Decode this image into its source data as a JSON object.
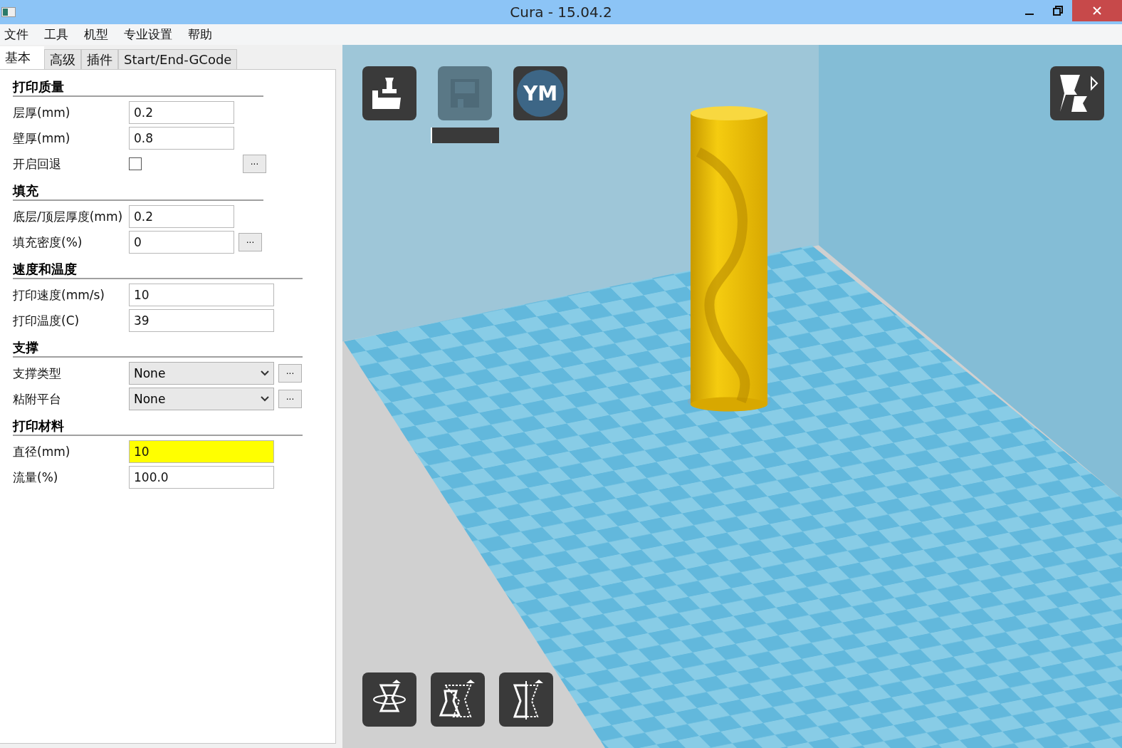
{
  "window": {
    "title": "Cura - 15.04.2"
  },
  "menu": [
    "文件",
    "工具",
    "机型",
    "专业设置",
    "帮助"
  ],
  "tabs": [
    {
      "label": "基本",
      "selected": true
    },
    {
      "label": "高级",
      "selected": false
    },
    {
      "label": "插件",
      "selected": false
    },
    {
      "label": "Start/End-GCode",
      "selected": false
    }
  ],
  "sections": [
    {
      "title": "打印质量",
      "rows": [
        {
          "kind": "input",
          "label": "层厚(mm)",
          "value": "0.2",
          "highlighted": false
        },
        {
          "kind": "input",
          "label": "壁厚(mm)",
          "value": "0.8",
          "highlighted": false
        },
        {
          "kind": "checkbox",
          "label": "开启回退",
          "checked": false,
          "more": "..."
        }
      ]
    },
    {
      "title": "填充",
      "rows": [
        {
          "kind": "input",
          "label": "底层/顶层厚度(mm)",
          "value": "0.2",
          "highlighted": false
        },
        {
          "kind": "input",
          "label": "填充密度(%)",
          "value": "0",
          "highlighted": false,
          "more": "..."
        }
      ]
    },
    {
      "title": "速度和温度",
      "rows": [
        {
          "kind": "input",
          "label": "打印速度(mm/s)",
          "value": "10",
          "highlighted": false
        },
        {
          "kind": "input",
          "label": "打印温度(C)",
          "value": "39",
          "highlighted": false
        }
      ]
    },
    {
      "title": "支撑",
      "rows": [
        {
          "kind": "select",
          "label": "支撑类型",
          "value": "None",
          "more": "..."
        },
        {
          "kind": "select",
          "label": "粘附平台",
          "value": "None",
          "more": "..."
        }
      ]
    },
    {
      "title": "打印材料",
      "rows": [
        {
          "kind": "input",
          "label": "直径(mm)",
          "value": "10",
          "highlighted": true
        },
        {
          "kind": "input",
          "label": "流量(%)",
          "value": "100.0",
          "highlighted": false
        }
      ]
    }
  ],
  "toolbar": [
    {
      "kind": "load",
      "disabled": false
    },
    {
      "kind": "save",
      "disabled": true
    },
    {
      "kind": "ym",
      "text": "YM",
      "disabled": false
    }
  ],
  "progress": {
    "level": 0.02
  },
  "tools": [
    {
      "kind": "rotate"
    },
    {
      "kind": "scale"
    },
    {
      "kind": "mirror"
    }
  ]
}
